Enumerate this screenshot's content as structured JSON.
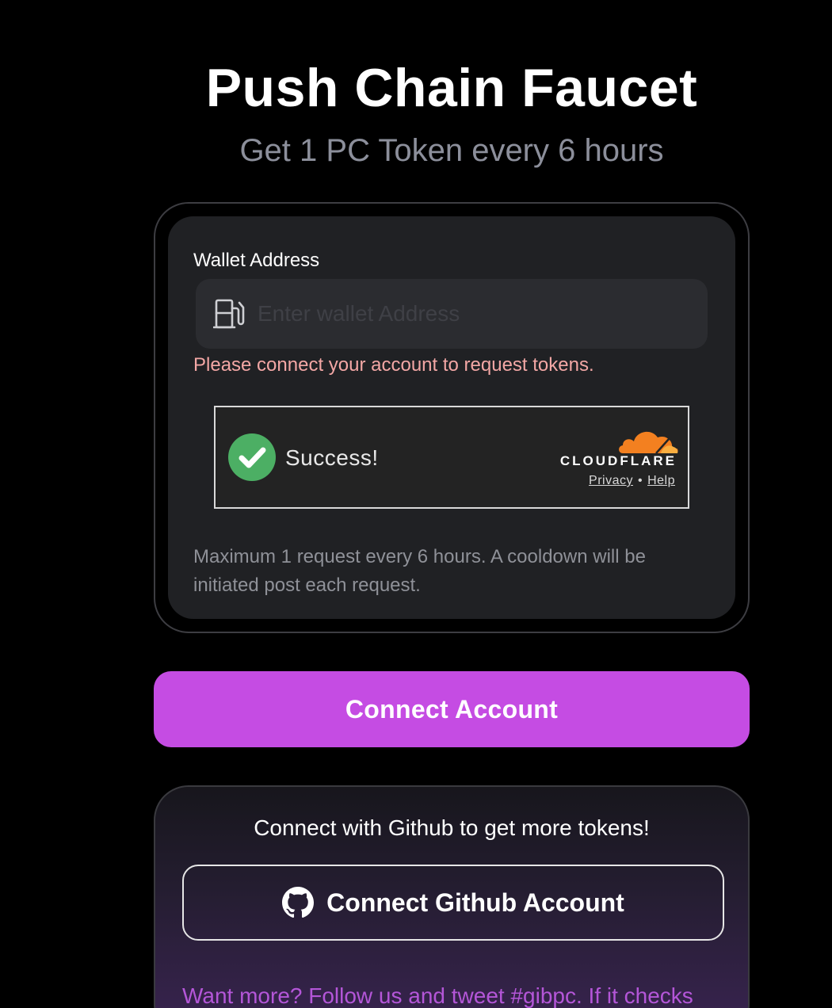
{
  "header": {
    "title": "Push Chain Faucet",
    "subtitle": "Get 1 PC Token every 6 hours"
  },
  "faucet_card": {
    "wallet_label": "Wallet Address",
    "wallet_placeholder": "Enter wallet Address",
    "wallet_value": "",
    "fuel_icon": "gas-pump-icon",
    "error_message": "Please connect your account to request tokens.",
    "captcha": {
      "status_text": "Success!",
      "brand": "CLOUDFLARE",
      "privacy_link": "Privacy",
      "separator": "•",
      "help_link": "Help",
      "check_color": "#4caf64",
      "cloud_color": "#f38020"
    },
    "info_text": "Maximum 1 request every 6 hours. A cooldown will be initiated post each request."
  },
  "connect_account_button": {
    "label": "Connect Account",
    "color": "#c54ce3"
  },
  "github_card": {
    "heading": "Connect with Github to get more tokens!",
    "button_label": "Connect Github Account",
    "button_icon": "github-icon",
    "more_text": "Want more? Follow us and tweet #gibpc. If it checks",
    "accent_color": "#b456d8"
  }
}
